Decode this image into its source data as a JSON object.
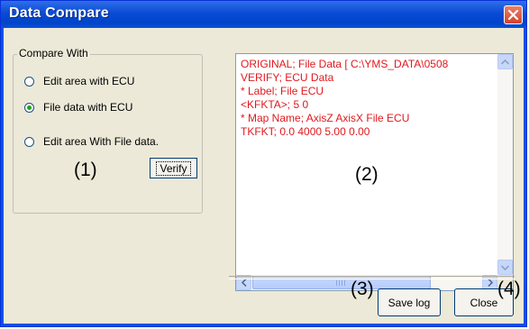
{
  "window": {
    "title": "Data Compare"
  },
  "compare_with": {
    "legend": "Compare With",
    "options": [
      {
        "label": "Edit area with ECU",
        "selected": false
      },
      {
        "label": "File data with ECU",
        "selected": true
      },
      {
        "label": "Edit area With File data.",
        "selected": false
      }
    ],
    "verify_label": "Verify"
  },
  "log": {
    "lines": [
      "ORIGINAL; File Data [ C:\\YMS_DATA\\0508",
      "VERIFY; ECU Data",
      "* Label; File ECU",
      "<KFKTA>; 5 0",
      "* Map Name; AxisZ AxisX File ECU",
      "TKFKT; 0.0 4000 5.00 0.00"
    ],
    "text_color": "#e0191e"
  },
  "buttons": {
    "save_log": "Save log",
    "close": "Close"
  },
  "annotations": {
    "a1": "(1)",
    "a2": "(2)",
    "a3": "(3)",
    "a4": "(4)"
  },
  "icons": [
    "close-icon",
    "scroll-up-icon",
    "scroll-down-icon",
    "scroll-left-icon",
    "scroll-right-icon"
  ]
}
